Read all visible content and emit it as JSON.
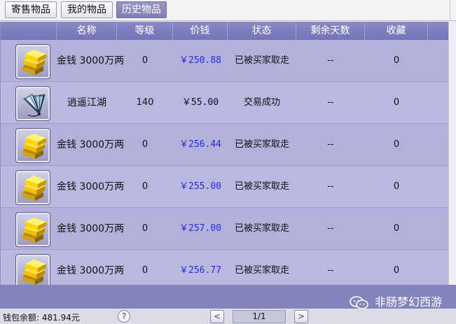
{
  "tabs": [
    {
      "label": "寄售物品",
      "active": false
    },
    {
      "label": "我的物品",
      "active": false
    },
    {
      "label": "历史物品",
      "active": true
    }
  ],
  "columns": [
    "名称",
    "等级",
    "价钱",
    "状态",
    "剩余天数",
    "收藏"
  ],
  "rows": [
    {
      "icon": "gold-bars-icon",
      "name": "金钱 3000万两",
      "level": "0",
      "price": "￥250.88",
      "price_color": "#2a2ad8",
      "status": "已被买家取走",
      "days": "--",
      "fav": "0"
    },
    {
      "icon": "fan-icon",
      "name": "逍遥江湖",
      "level": "140",
      "price": "￥55.00",
      "price_color": "#111111",
      "status": "交易成功",
      "days": "--",
      "fav": "0"
    },
    {
      "icon": "gold-bars-icon",
      "name": "金钱 3000万两",
      "level": "0",
      "price": "￥256.44",
      "price_color": "#2a2ad8",
      "status": "已被买家取走",
      "days": "--",
      "fav": "0"
    },
    {
      "icon": "gold-bars-icon",
      "name": "金钱 3000万两",
      "level": "0",
      "price": "￥255.00",
      "price_color": "#2a2ad8",
      "status": "已被买家取走",
      "days": "--",
      "fav": "0"
    },
    {
      "icon": "gold-bars-icon",
      "name": "金钱 3000万两",
      "level": "0",
      "price": "￥257.00",
      "price_color": "#2a2ad8",
      "status": "已被买家取走",
      "days": "--",
      "fav": "0"
    },
    {
      "icon": "gold-bars-icon",
      "name": "金钱 3000万两",
      "level": "0",
      "price": "￥256.77",
      "price_color": "#2a2ad8",
      "status": "已被买家取走",
      "days": "--",
      "fav": "0"
    }
  ],
  "footer": {
    "balance": "钱包余额: 481.94元",
    "help": "?",
    "prev": "<",
    "page": "1/1",
    "next": ">"
  },
  "watermark": {
    "text": "非肠梦幻西游",
    "icon": "wechat-icon"
  }
}
